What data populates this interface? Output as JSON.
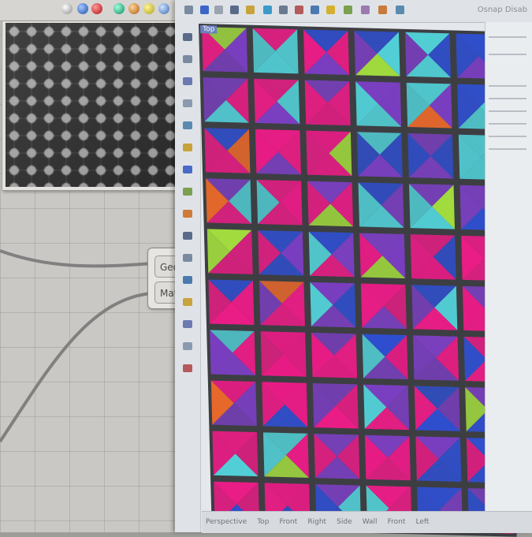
{
  "grasshopper": {
    "toolbar_icons": [
      "blue-sphere-icon",
      "blue-sphere-icon",
      "red-sphere-icon",
      "green-sphere-icon",
      "gradient-sphere-icon",
      "yellow-sphere-icon",
      "globe-icon"
    ],
    "preview_panel": {
      "image_alt": "grayscale texture preview"
    },
    "node": {
      "inputs": [
        {
          "label": "Geometr"
        },
        {
          "label": "Materia"
        }
      ]
    }
  },
  "rhino": {
    "status_text": "Osnap Disab",
    "viewport_label": "Top",
    "bottom_tabs": [
      "Perspective",
      "Top",
      "Front",
      "Right",
      "Side",
      "Wall",
      "Front",
      "Left"
    ]
  },
  "colors": {
    "magenta": "#ea1c86",
    "purple": "#7a3fc0",
    "blue": "#2f4fd0",
    "cyan": "#52cfd6",
    "lime": "#a3de3e",
    "orange": "#ef6a2a",
    "dark_gap": "#3d3e42"
  }
}
